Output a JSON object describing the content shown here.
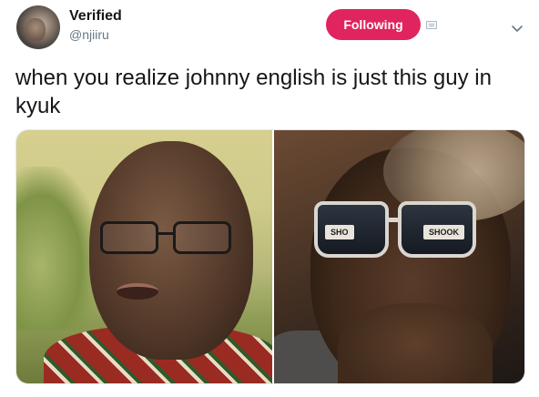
{
  "tweet": {
    "display_name": "Verified",
    "handle": "@njiiru",
    "follow_label": "Following",
    "text": "when you realize johnny english is just this guy in kyuk"
  },
  "media": {
    "right_glasses_text_left": "SHO",
    "right_glasses_text_right": "SHOOK"
  },
  "colors": {
    "follow_button": "#e0245e",
    "handle_gray": "#657786",
    "text": "#14171a"
  },
  "icons": {
    "notification": "notification-icon",
    "caret": "chevron-down-icon"
  }
}
